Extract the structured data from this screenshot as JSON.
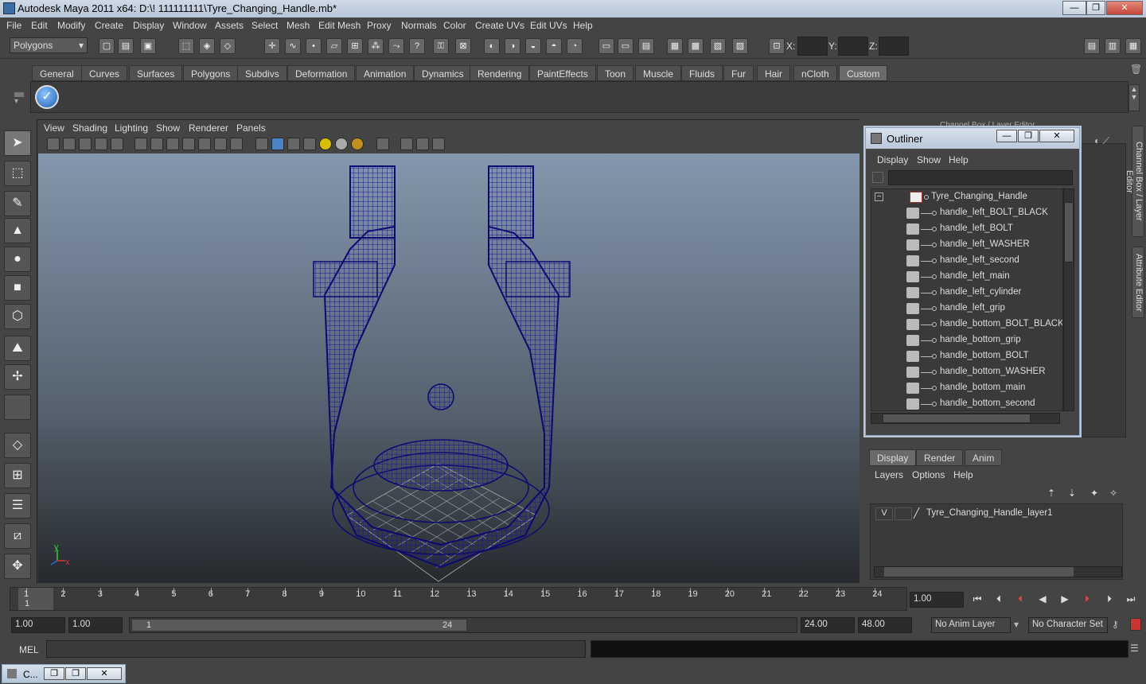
{
  "window": {
    "title": "Autodesk Maya 2011 x64: D:\\! 111111111\\Tyre_Changing_Handle.mb*",
    "min": "—",
    "max": "❐",
    "close": "✕"
  },
  "menubar": [
    "File",
    "Edit",
    "Modify",
    "Create",
    "Display",
    "Window",
    "Assets",
    "Select",
    "Mesh",
    "Edit Mesh",
    "Proxy",
    "Normals",
    "Color",
    "Create UVs",
    "Edit UVs",
    "Help"
  ],
  "status": {
    "mode": "Polygons",
    "x_label": "X:",
    "y_label": "Y:",
    "z_label": "Z:"
  },
  "shelf_tabs": [
    "General",
    "Curves",
    "Surfaces",
    "Polygons",
    "Subdivs",
    "Deformation",
    "Animation",
    "Dynamics",
    "Rendering",
    "PaintEffects",
    "Toon",
    "Muscle",
    "Fluids",
    "Fur",
    "Hair",
    "nCloth",
    "Custom"
  ],
  "shelf_active_tab": "Custom",
  "viewport": {
    "menu": [
      "View",
      "Shading",
      "Lighting",
      "Show",
      "Renderer",
      "Panels"
    ],
    "axis_y": "y",
    "axis_x": "x"
  },
  "outliner": {
    "title": "Outliner",
    "menu": [
      "Display",
      "Show",
      "Help"
    ],
    "expand_glyph": "−",
    "root": "Tyre_Changing_Handle",
    "items": [
      "handle_left_BOLT_BLACK",
      "handle_left_BOLT",
      "handle_left_WASHER",
      "handle_left_second",
      "handle_left_main",
      "handle_left_cylinder",
      "handle_left_grip",
      "handle_bottom_BOLT_BLACK",
      "handle_bottom_grip",
      "handle_bottom_BOLT",
      "handle_bottom_WASHER",
      "handle_bottom_main",
      "handle_bottom_second"
    ]
  },
  "channelbox_label": "Channel Box / Layer Editor",
  "side_tabs": [
    "Channel Box / Layer Editor",
    "Attribute Editor"
  ],
  "layers": {
    "tabs": [
      "Display",
      "Render",
      "Anim"
    ],
    "menu": [
      "Layers",
      "Options",
      "Help"
    ],
    "visible": "V",
    "layer_name": "Tyre_Changing_Handle_layer1"
  },
  "timeline": {
    "ticks": [
      "1",
      "2",
      "3",
      "4",
      "5",
      "6",
      "7",
      "8",
      "9",
      "10",
      "11",
      "12",
      "13",
      "14",
      "15",
      "16",
      "17",
      "18",
      "19",
      "20",
      "21",
      "22",
      "23",
      "24"
    ],
    "current_frame": "1",
    "current_value": "1.00"
  },
  "range": {
    "start": "1.00",
    "start2": "1.00",
    "slider_start": "1",
    "slider_end": "24",
    "end": "24.00",
    "end2": "48.00",
    "anim_layer": "No Anim Layer",
    "char_set": "No Character Set"
  },
  "cmd": {
    "label": "MEL"
  },
  "taskbar": {
    "label": "C..."
  }
}
